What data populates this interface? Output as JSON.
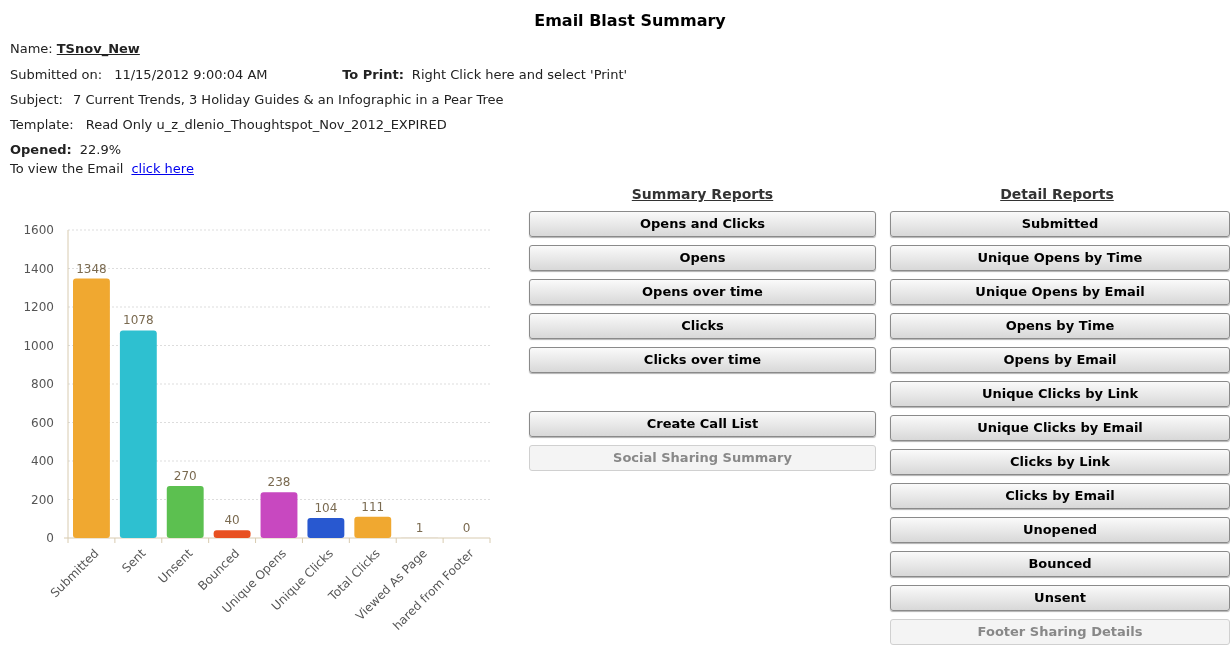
{
  "title": "Email Blast Summary",
  "name": {
    "label": "Name:",
    "value": "TSnov_New"
  },
  "submitted": {
    "label": "Submitted on:",
    "value": "11/15/2012 9:00:04 AM"
  },
  "print": {
    "label": "To Print:",
    "value": "Right Click here and select 'Print'"
  },
  "subject": {
    "label": "Subject:",
    "value": "7 Current Trends, 3 Holiday Guides & an Infographic in a Pear Tree"
  },
  "template": {
    "label": "Template:",
    "value": "Read Only u_z_dlenio_Thoughtspot_Nov_2012_EXPIRED"
  },
  "opened": {
    "label": "Opened:",
    "value": "22.9%"
  },
  "view": {
    "text": "To view the Email",
    "link": "click here"
  },
  "chart": {
    "chart_data": {
      "type": "bar",
      "categories": [
        "Submitted",
        "Sent",
        "Unsent",
        "Bounced",
        "Unique Opens",
        "Unique Clicks",
        "Total Clicks",
        "Viewed As Page",
        "hared from Footer"
      ],
      "values": [
        1348,
        1078,
        270,
        40,
        238,
        104,
        111,
        1,
        0
      ],
      "colors": [
        "#f0a830",
        "#2ec0d0",
        "#5cc050",
        "#e85020",
        "#c848c0",
        "#2858d0",
        "#f0a830",
        "#d8d0c0",
        "#d8d0c0"
      ],
      "ylim": [
        0,
        1600
      ],
      "yticks": [
        0,
        200,
        400,
        600,
        800,
        1000,
        1200,
        1400,
        1600
      ],
      "grid": true,
      "data_labels": true
    }
  },
  "summary_reports": {
    "heading": "Summary Reports",
    "buttons": [
      {
        "label": "Opens and Clicks",
        "disabled": false
      },
      {
        "label": "Opens",
        "disabled": false
      },
      {
        "label": "Opens over time",
        "disabled": false
      },
      {
        "label": "Clicks",
        "disabled": false
      },
      {
        "label": "Clicks over time",
        "disabled": false
      }
    ],
    "actions": [
      {
        "label": "Create Call List",
        "disabled": false
      },
      {
        "label": "Social Sharing Summary",
        "disabled": true
      }
    ]
  },
  "detail_reports": {
    "heading": "Detail Reports",
    "buttons": [
      {
        "label": "Submitted",
        "disabled": false
      },
      {
        "label": "Unique Opens by Time",
        "disabled": false
      },
      {
        "label": "Unique Opens by Email",
        "disabled": false
      },
      {
        "label": "Opens by Time",
        "disabled": false
      },
      {
        "label": "Opens by Email",
        "disabled": false
      },
      {
        "label": "Unique Clicks by Link",
        "disabled": false
      },
      {
        "label": "Unique Clicks by Email",
        "disabled": false
      },
      {
        "label": "Clicks by Link",
        "disabled": false
      },
      {
        "label": "Clicks by Email",
        "disabled": false
      },
      {
        "label": "Unopened",
        "disabled": false
      },
      {
        "label": "Bounced",
        "disabled": false
      },
      {
        "label": "Unsent",
        "disabled": false
      },
      {
        "label": "Footer Sharing Details",
        "disabled": true
      }
    ]
  }
}
